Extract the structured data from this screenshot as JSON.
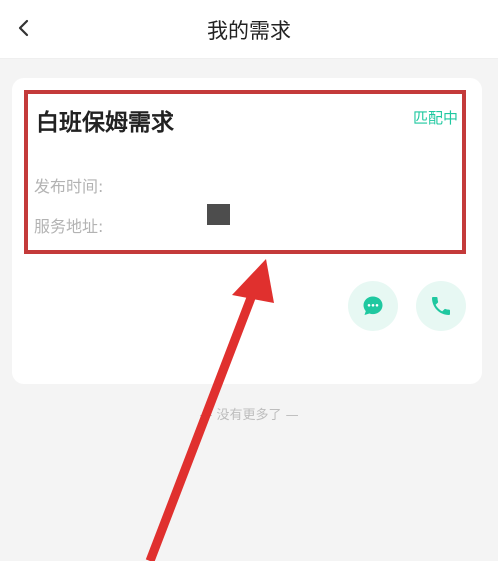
{
  "header": {
    "title": "我的需求",
    "back_icon": "chevron-left-icon"
  },
  "card": {
    "title": "白班保姆需求",
    "status": "匹配中",
    "fields": {
      "time_label": "发布时间:",
      "address_label": "服务地址:"
    },
    "actions": {
      "chat_icon": "chat-bubble-icon",
      "call_icon": "phone-icon"
    }
  },
  "list_end_text": "— 没有更多了 —",
  "colors": {
    "accent": "#1fc8a0",
    "annotation_red": "#e0302e",
    "highlight_border": "#c43a3a"
  }
}
